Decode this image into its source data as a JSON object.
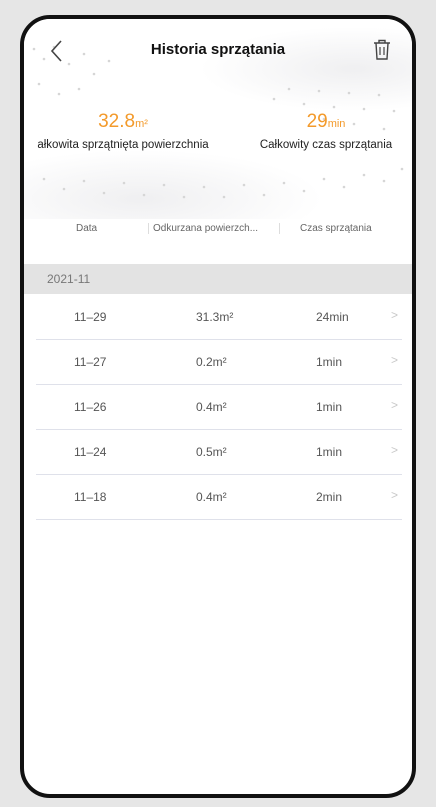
{
  "header": {
    "title": "Historia sprzątania"
  },
  "stats": {
    "area": {
      "value": "32.8",
      "unit": "m²",
      "label": "ałkowita sprzątnięta powierzchnia"
    },
    "time": {
      "value": "29",
      "unit": "min",
      "label": "Całkowity czas sprzątania"
    }
  },
  "columns": {
    "date": "Data",
    "area": "Odkurzana powierzch...",
    "time": "Czas sprzątania"
  },
  "month": "2021-11",
  "records": [
    {
      "date": "11–29",
      "area": "31.3m²",
      "time": "24min"
    },
    {
      "date": "11–27",
      "area": "0.2m²",
      "time": "1min"
    },
    {
      "date": "11–26",
      "area": "0.4m²",
      "time": "1min"
    },
    {
      "date": "11–24",
      "area": "0.5m²",
      "time": "1min"
    },
    {
      "date": "11–18",
      "area": "0.4m²",
      "time": "2min"
    }
  ],
  "colors": {
    "accent": "#f39a2b",
    "separator": "#e3e3e3"
  },
  "icons": {
    "back": "chevron-left-icon",
    "delete": "trash-icon",
    "row": "chevron-right-icon"
  }
}
